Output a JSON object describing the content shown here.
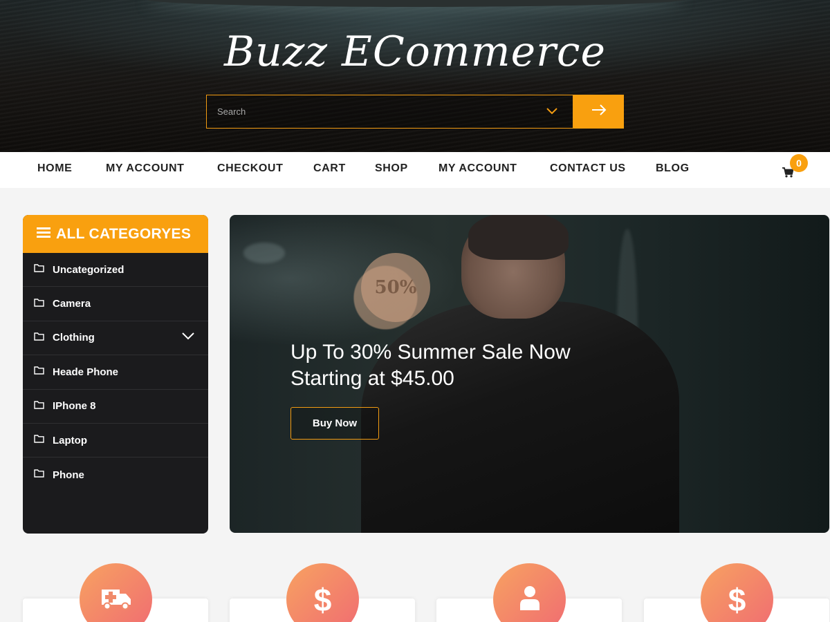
{
  "header": {
    "site_title": "Buzz ECommerce",
    "search": {
      "placeholder": "Search"
    }
  },
  "nav": {
    "items": [
      "HOME",
      "MY ACCOUNT",
      "CHECKOUT",
      "CART",
      "SHOP",
      "MY ACCOUNT",
      "CONTACT US",
      "BLOG"
    ],
    "cart_count": "0"
  },
  "sidebar": {
    "title": "ALL CATEGORYES",
    "categories": [
      "Uncategorized",
      "Camera",
      "Clothing",
      "Heade Phone",
      "IPhone 8",
      "Laptop",
      "Phone"
    ]
  },
  "banner": {
    "badge": "50%",
    "title_line1": "Up To 30% Summer Sale Now",
    "title_line2": "Starting at $45.00",
    "button_label": "Buy Now"
  },
  "features": {
    "icons": [
      "ambulance-icon",
      "dollar-icon",
      "user-icon",
      "dollar-icon"
    ]
  },
  "colors": {
    "accent": "#f9a00f",
    "sidebar_bg": "#1b1b1d",
    "feature_gradient_start": "#f7a261",
    "feature_gradient_end": "#f06b72"
  }
}
